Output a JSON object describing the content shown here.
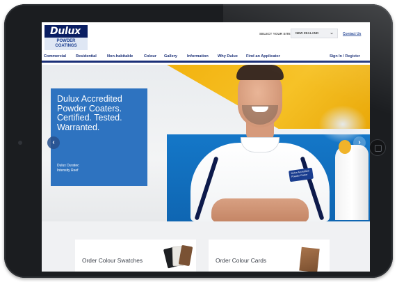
{
  "header": {
    "logo_brand": "Dulux",
    "logo_sub_line1": "POWDER",
    "logo_sub_line2": "COATINGS",
    "site_select_label": "SELECT YOUR SITE:",
    "site_select_value": "NEW ZEALAND",
    "contact_link": "Contact Us"
  },
  "nav": {
    "items": [
      {
        "label": "Commercial"
      },
      {
        "label": "Residential"
      },
      {
        "label": "Non-habitable"
      },
      {
        "label": "Colour"
      },
      {
        "label": "Gallery"
      },
      {
        "label": "Information"
      },
      {
        "label": "Why Dulux"
      },
      {
        "label": "Find an Applicator"
      }
    ],
    "signin": "Sign In / Register"
  },
  "hero": {
    "headline": "Dulux Accredited\nPowder Coaters.\nCertified. Tested.\nWarranted.",
    "caption": "Dulux Duratec\nIntensity Reef",
    "badge_text": "Dulux Accredited Powder Coater"
  },
  "cards": [
    {
      "label": "Order Colour Swatches"
    },
    {
      "label": "Order Colour Cards"
    }
  ],
  "icons": {
    "prev": "chevron-left-icon",
    "next": "chevron-right-icon",
    "dropdown": "chevron-down-icon"
  },
  "colors": {
    "brand_navy": "#0a1e62",
    "promo_blue": "#2e73c0",
    "accent_yellow": "#f2b20f"
  }
}
